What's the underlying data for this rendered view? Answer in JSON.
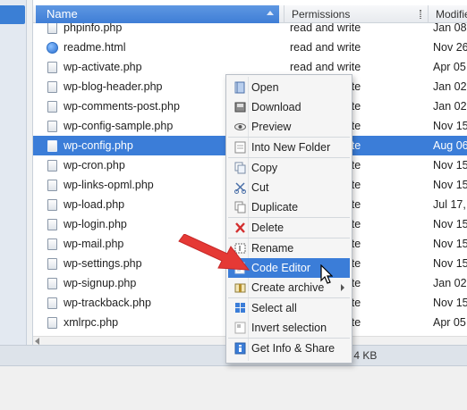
{
  "columns": {
    "name": "Name",
    "permissions": "Permissions",
    "modified": "Modifie"
  },
  "files": [
    {
      "name": "phpinfo.php",
      "permissions": "read and write",
      "modified": "Jan 08",
      "icon": "php-file-icon"
    },
    {
      "name": "readme.html",
      "permissions": "read and write",
      "modified": "Nov 26",
      "icon": "html-file-icon"
    },
    {
      "name": "wp-activate.php",
      "permissions": "read and write",
      "modified": "Apr 05",
      "icon": "php-file-icon"
    },
    {
      "name": "wp-blog-header.php",
      "permissions": "read and write",
      "modified": "Jan 02",
      "icon": "php-file-icon"
    },
    {
      "name": "wp-comments-post.php",
      "permissions": "read and write",
      "modified": "Jan 02",
      "icon": "php-file-icon"
    },
    {
      "name": "wp-config-sample.php",
      "permissions": "read and write",
      "modified": "Nov 15",
      "icon": "php-file-icon"
    },
    {
      "name": "wp-config.php",
      "permissions": "read and write",
      "modified": "Aug 06",
      "icon": "php-file-icon",
      "selected": true
    },
    {
      "name": "wp-cron.php",
      "permissions": "read and write",
      "modified": "Nov 15",
      "icon": "php-file-icon"
    },
    {
      "name": "wp-links-opml.php",
      "permissions": "read and write",
      "modified": "Nov 15",
      "icon": "php-file-icon"
    },
    {
      "name": "wp-load.php",
      "permissions": "read and write",
      "modified": "Jul 17,",
      "icon": "php-file-icon"
    },
    {
      "name": "wp-login.php",
      "permissions": "read and write",
      "modified": "Nov 15",
      "icon": "php-file-icon"
    },
    {
      "name": "wp-mail.php",
      "permissions": "read and write",
      "modified": "Nov 15",
      "icon": "php-file-icon"
    },
    {
      "name": "wp-settings.php",
      "permissions": "read and write",
      "modified": "Nov 15",
      "icon": "php-file-icon"
    },
    {
      "name": "wp-signup.php",
      "permissions": "read and write",
      "modified": "Jan 02",
      "icon": "php-file-icon"
    },
    {
      "name": "wp-trackback.php",
      "permissions": "read and write",
      "modified": "Nov 15",
      "icon": "php-file-icon"
    },
    {
      "name": "xmlrpc.php",
      "permissions": "read and write",
      "modified": "Apr 05",
      "icon": "php-file-icon"
    }
  ],
  "context_menu": [
    {
      "label": "Open",
      "icon": "open-file-icon"
    },
    {
      "label": "Download",
      "icon": "download-icon"
    },
    {
      "label": "Preview",
      "icon": "eye-icon"
    },
    {
      "separator": true
    },
    {
      "label": "Into New Folder",
      "icon": "new-folder-icon"
    },
    {
      "separator": true
    },
    {
      "label": "Copy",
      "icon": "copy-icon"
    },
    {
      "label": "Cut",
      "icon": "scissors-icon"
    },
    {
      "label": "Duplicate",
      "icon": "duplicate-icon"
    },
    {
      "separator": true
    },
    {
      "label": "Delete",
      "icon": "delete-x-icon"
    },
    {
      "separator": true
    },
    {
      "label": "Rename",
      "icon": "rename-icon"
    },
    {
      "label": "Code Editor",
      "icon": "code-editor-icon",
      "highlighted": true
    },
    {
      "label": "Create archive",
      "icon": "archive-icon",
      "submenu": true
    },
    {
      "separator": true
    },
    {
      "label": "Select all",
      "icon": "select-all-icon"
    },
    {
      "label": "Invert selection",
      "icon": "invert-selection-icon"
    },
    {
      "separator": true
    },
    {
      "label": "Get Info & Share",
      "icon": "info-icon"
    }
  ],
  "status": {
    "text": "p, 4 KB"
  },
  "colors": {
    "selection": "#3b7dd8",
    "annotation_arrow": "#e53935"
  }
}
